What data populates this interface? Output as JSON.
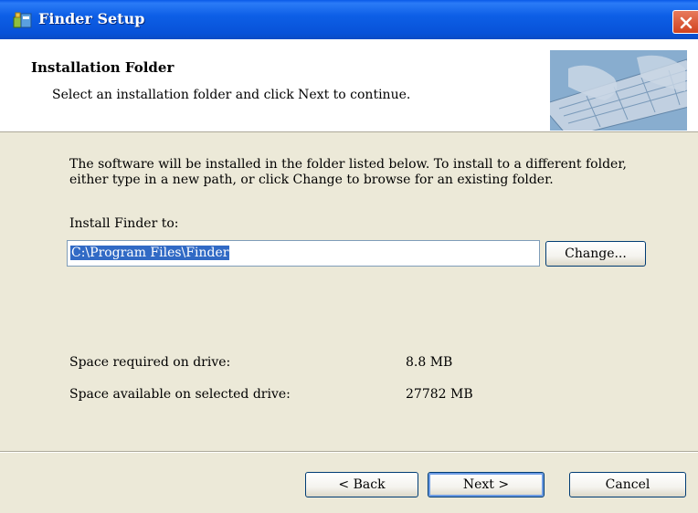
{
  "window": {
    "title": "Finder Setup"
  },
  "header": {
    "title": "Installation Folder",
    "subtitle": "Select an installation folder and click Next to continue.",
    "banner_icon": "keyboard-hands-image"
  },
  "body": {
    "description_line1": "The software will be installed in the folder listed below. To install to a different folder,",
    "description_line2": "either type in a new path, or click Change to browse for an existing folder.",
    "install_label": "Install Finder to:",
    "install_path": "C:\\Program Files\\Finder",
    "change_label": "Change..."
  },
  "space": {
    "required_label": "Space required on drive:",
    "required_value": "8.8 MB",
    "available_label": "Space available on selected drive:",
    "available_value": "27782 MB"
  },
  "buttons": {
    "back": "< Back",
    "next": "Next >",
    "cancel": "Cancel"
  },
  "colors": {
    "titlebar": "#0852d8",
    "selection": "#316ac5",
    "dialog_bg": "#ece9d8"
  }
}
